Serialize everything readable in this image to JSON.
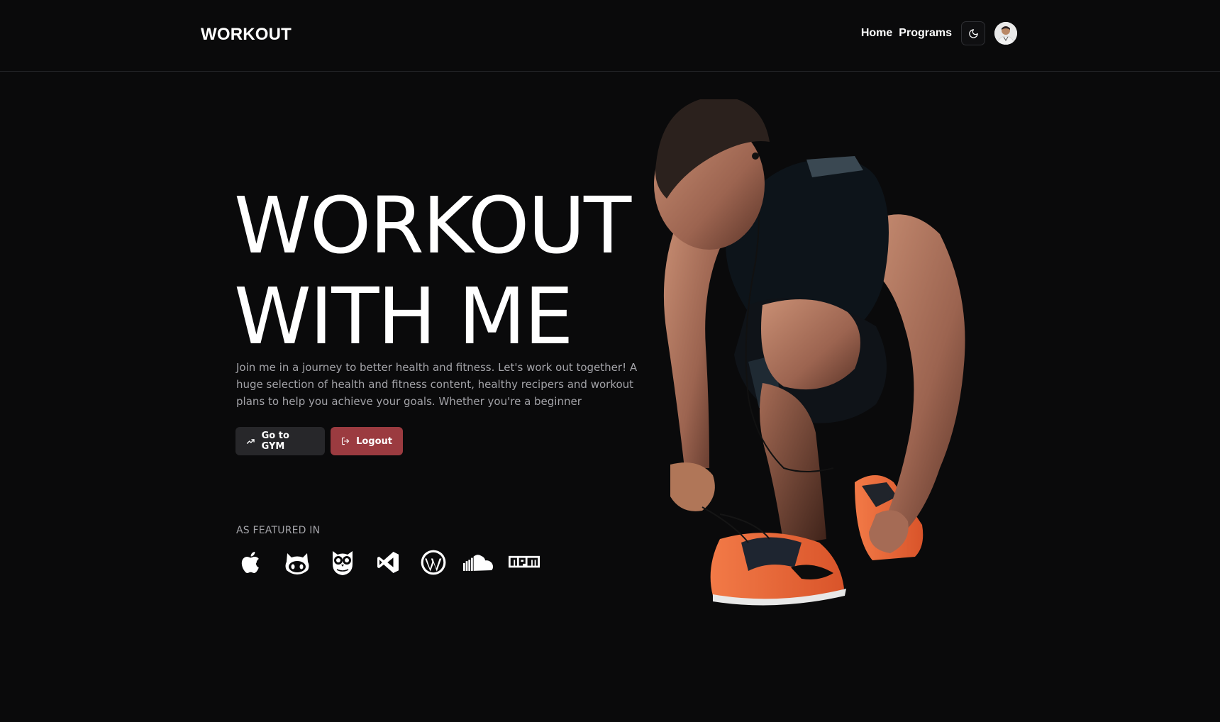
{
  "navbar": {
    "logo": "WORKOUT",
    "links": [
      "Home",
      "Programs"
    ],
    "theme_toggle_icon": "moon-icon",
    "avatar_icon": "user-avatar"
  },
  "hero": {
    "title_line1": "WORKOUT",
    "title_line2": "WITH ME",
    "subtitle": "Join me in a journey to better health and fitness. Let's work out together! A huge selection of health and fitness content, healthy recipers and workout plans to help you achieve your goals. Whether you're a beginner",
    "buttons": {
      "gym": {
        "label": "Go to GYM",
        "icon": "trending-up-icon"
      },
      "logout": {
        "label": "Logout",
        "icon": "logout-icon"
      }
    }
  },
  "featured": {
    "label": "AS FEATURED IN",
    "logos": [
      "apple-icon",
      "github-icon",
      "hootsuite-icon",
      "visual-studio-icon",
      "wordpress-icon",
      "soundcloud-icon",
      "npm-icon"
    ]
  },
  "colors": {
    "background": "#0a0a0b",
    "logout_button": "#9b3b40",
    "gym_button": "#27272a",
    "shoe_accent": "#ef6a3a"
  }
}
